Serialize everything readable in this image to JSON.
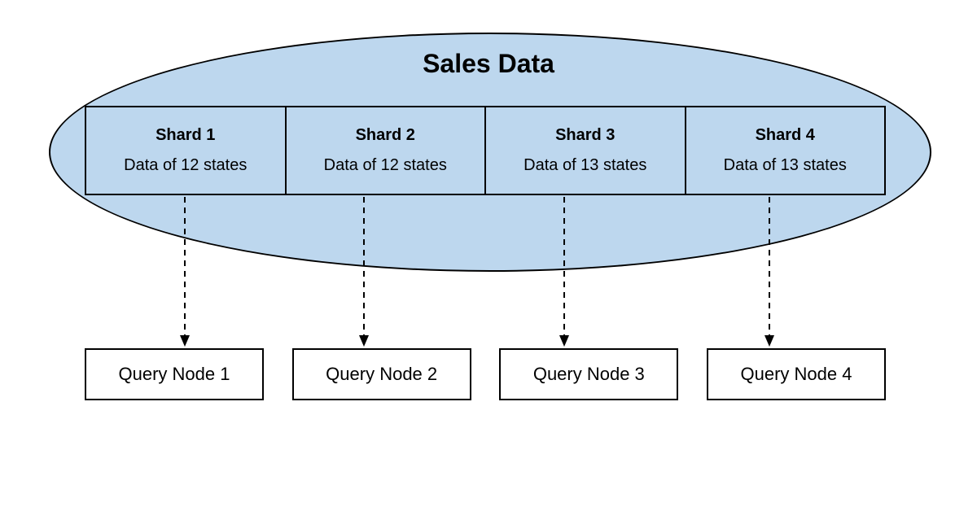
{
  "title": "Sales Data",
  "shards": [
    {
      "name": "Shard 1",
      "desc": "Data of 12 states"
    },
    {
      "name": "Shard 2",
      "desc": "Data of 12 states"
    },
    {
      "name": "Shard 3",
      "desc": "Data of 13 states"
    },
    {
      "name": "Shard 4",
      "desc": "Data of 13 states"
    }
  ],
  "nodes": [
    {
      "label": "Query Node 1"
    },
    {
      "label": "Query Node 2"
    },
    {
      "label": "Query Node 3"
    },
    {
      "label": "Query Node 4"
    }
  ],
  "colors": {
    "ellipse_fill": "#bdd7ee",
    "stroke": "#000000"
  }
}
